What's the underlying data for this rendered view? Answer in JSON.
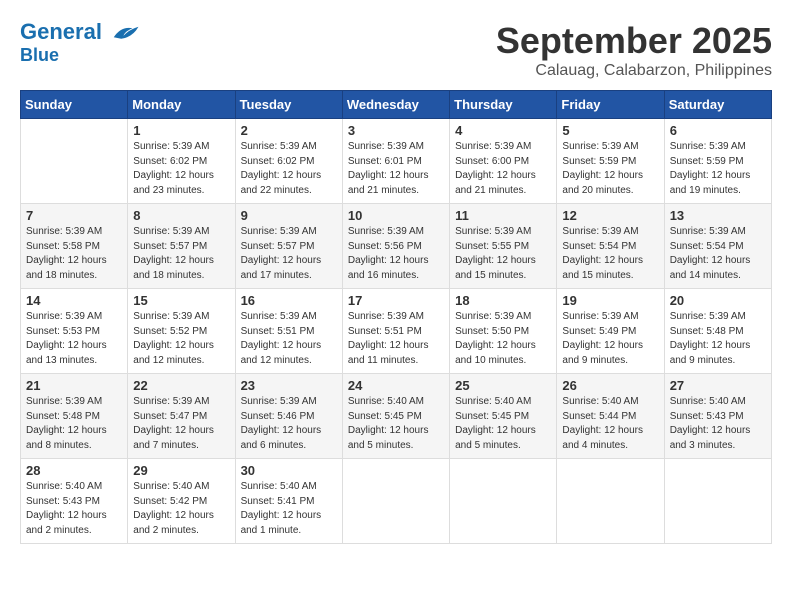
{
  "header": {
    "logo_line1": "General",
    "logo_line2": "Blue",
    "month_title": "September 2025",
    "location": "Calauag, Calabarzon, Philippines"
  },
  "days_of_week": [
    "Sunday",
    "Monday",
    "Tuesday",
    "Wednesday",
    "Thursday",
    "Friday",
    "Saturday"
  ],
  "weeks": [
    [
      {
        "day": "",
        "info": ""
      },
      {
        "day": "1",
        "info": "Sunrise: 5:39 AM\nSunset: 6:02 PM\nDaylight: 12 hours\nand 23 minutes."
      },
      {
        "day": "2",
        "info": "Sunrise: 5:39 AM\nSunset: 6:02 PM\nDaylight: 12 hours\nand 22 minutes."
      },
      {
        "day": "3",
        "info": "Sunrise: 5:39 AM\nSunset: 6:01 PM\nDaylight: 12 hours\nand 21 minutes."
      },
      {
        "day": "4",
        "info": "Sunrise: 5:39 AM\nSunset: 6:00 PM\nDaylight: 12 hours\nand 21 minutes."
      },
      {
        "day": "5",
        "info": "Sunrise: 5:39 AM\nSunset: 5:59 PM\nDaylight: 12 hours\nand 20 minutes."
      },
      {
        "day": "6",
        "info": "Sunrise: 5:39 AM\nSunset: 5:59 PM\nDaylight: 12 hours\nand 19 minutes."
      }
    ],
    [
      {
        "day": "7",
        "info": "Sunrise: 5:39 AM\nSunset: 5:58 PM\nDaylight: 12 hours\nand 18 minutes."
      },
      {
        "day": "8",
        "info": "Sunrise: 5:39 AM\nSunset: 5:57 PM\nDaylight: 12 hours\nand 18 minutes."
      },
      {
        "day": "9",
        "info": "Sunrise: 5:39 AM\nSunset: 5:57 PM\nDaylight: 12 hours\nand 17 minutes."
      },
      {
        "day": "10",
        "info": "Sunrise: 5:39 AM\nSunset: 5:56 PM\nDaylight: 12 hours\nand 16 minutes."
      },
      {
        "day": "11",
        "info": "Sunrise: 5:39 AM\nSunset: 5:55 PM\nDaylight: 12 hours\nand 15 minutes."
      },
      {
        "day": "12",
        "info": "Sunrise: 5:39 AM\nSunset: 5:54 PM\nDaylight: 12 hours\nand 15 minutes."
      },
      {
        "day": "13",
        "info": "Sunrise: 5:39 AM\nSunset: 5:54 PM\nDaylight: 12 hours\nand 14 minutes."
      }
    ],
    [
      {
        "day": "14",
        "info": "Sunrise: 5:39 AM\nSunset: 5:53 PM\nDaylight: 12 hours\nand 13 minutes."
      },
      {
        "day": "15",
        "info": "Sunrise: 5:39 AM\nSunset: 5:52 PM\nDaylight: 12 hours\nand 12 minutes."
      },
      {
        "day": "16",
        "info": "Sunrise: 5:39 AM\nSunset: 5:51 PM\nDaylight: 12 hours\nand 12 minutes."
      },
      {
        "day": "17",
        "info": "Sunrise: 5:39 AM\nSunset: 5:51 PM\nDaylight: 12 hours\nand 11 minutes."
      },
      {
        "day": "18",
        "info": "Sunrise: 5:39 AM\nSunset: 5:50 PM\nDaylight: 12 hours\nand 10 minutes."
      },
      {
        "day": "19",
        "info": "Sunrise: 5:39 AM\nSunset: 5:49 PM\nDaylight: 12 hours\nand 9 minutes."
      },
      {
        "day": "20",
        "info": "Sunrise: 5:39 AM\nSunset: 5:48 PM\nDaylight: 12 hours\nand 9 minutes."
      }
    ],
    [
      {
        "day": "21",
        "info": "Sunrise: 5:39 AM\nSunset: 5:48 PM\nDaylight: 12 hours\nand 8 minutes."
      },
      {
        "day": "22",
        "info": "Sunrise: 5:39 AM\nSunset: 5:47 PM\nDaylight: 12 hours\nand 7 minutes."
      },
      {
        "day": "23",
        "info": "Sunrise: 5:39 AM\nSunset: 5:46 PM\nDaylight: 12 hours\nand 6 minutes."
      },
      {
        "day": "24",
        "info": "Sunrise: 5:40 AM\nSunset: 5:45 PM\nDaylight: 12 hours\nand 5 minutes."
      },
      {
        "day": "25",
        "info": "Sunrise: 5:40 AM\nSunset: 5:45 PM\nDaylight: 12 hours\nand 5 minutes."
      },
      {
        "day": "26",
        "info": "Sunrise: 5:40 AM\nSunset: 5:44 PM\nDaylight: 12 hours\nand 4 minutes."
      },
      {
        "day": "27",
        "info": "Sunrise: 5:40 AM\nSunset: 5:43 PM\nDaylight: 12 hours\nand 3 minutes."
      }
    ],
    [
      {
        "day": "28",
        "info": "Sunrise: 5:40 AM\nSunset: 5:43 PM\nDaylight: 12 hours\nand 2 minutes."
      },
      {
        "day": "29",
        "info": "Sunrise: 5:40 AM\nSunset: 5:42 PM\nDaylight: 12 hours\nand 2 minutes."
      },
      {
        "day": "30",
        "info": "Sunrise: 5:40 AM\nSunset: 5:41 PM\nDaylight: 12 hours\nand 1 minute."
      },
      {
        "day": "",
        "info": ""
      },
      {
        "day": "",
        "info": ""
      },
      {
        "day": "",
        "info": ""
      },
      {
        "day": "",
        "info": ""
      }
    ]
  ]
}
